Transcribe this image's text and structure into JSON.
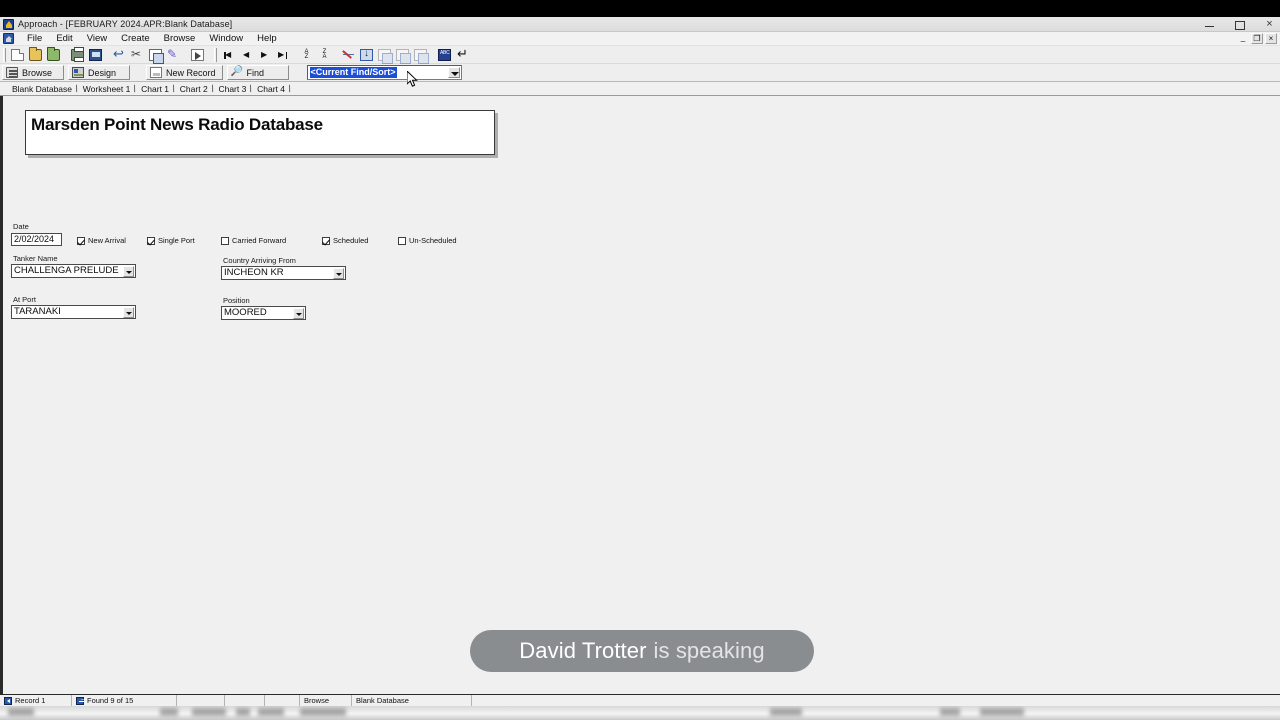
{
  "window": {
    "title": "Approach - [FEBRUARY 2024.APR:Blank Database]",
    "minimize_label": "",
    "maximize_label": "",
    "close_label": "×",
    "mdi_minimize_label": "_",
    "mdi_restore_label": "❐",
    "mdi_close_label": "×"
  },
  "menubar": {
    "items": [
      {
        "label": "File"
      },
      {
        "label": "Edit"
      },
      {
        "label": "View"
      },
      {
        "label": "Create"
      },
      {
        "label": "Browse"
      },
      {
        "label": "Window"
      },
      {
        "label": "Help"
      }
    ]
  },
  "toolbar": {
    "buttons": [
      {
        "name": "new-file-icon"
      },
      {
        "name": "open-folder-icon"
      },
      {
        "name": "save-folder-icon"
      },
      {
        "name": "print-icon"
      },
      {
        "name": "print-preview-icon"
      },
      {
        "name": "undo-icon"
      },
      {
        "name": "cut-icon"
      },
      {
        "name": "copy-icon"
      },
      {
        "name": "paste-format-icon"
      },
      {
        "name": "export-icon"
      },
      {
        "name": "first-record-icon"
      },
      {
        "name": "previous-record-icon"
      },
      {
        "name": "next-record-icon"
      },
      {
        "name": "last-record-icon"
      },
      {
        "name": "sort-ascending-icon"
      },
      {
        "name": "sort-descending-icon"
      },
      {
        "name": "clear-sort-icon"
      },
      {
        "name": "find-sort-icon"
      },
      {
        "name": "new-record-icon"
      },
      {
        "name": "duplicate-record-icon"
      },
      {
        "name": "delete-record-icon"
      },
      {
        "name": "spellcheck-icon"
      },
      {
        "name": "enter-icon"
      }
    ],
    "sort_asc_label": "A\nZ",
    "sort_desc_label": "Z\nA",
    "spell_label": "ABC"
  },
  "actionbar": {
    "browse_label": "Browse",
    "design_label": "Design",
    "new_record_label": "New Record",
    "find_label": "Find",
    "findsort_value": "<Current Find/Sort>",
    "findsort_placeholder": "<Current Find/Sort>"
  },
  "tabs": [
    {
      "label": "Blank Database",
      "active": true
    },
    {
      "label": "Worksheet 1",
      "active": false
    },
    {
      "label": "Chart 1",
      "active": false
    },
    {
      "label": "Chart 2",
      "active": false
    },
    {
      "label": "Chart 3",
      "active": false
    },
    {
      "label": "Chart 4",
      "active": false
    }
  ],
  "form": {
    "title": "Marsden Point News Radio Database",
    "fields": {
      "date": {
        "label": "Date",
        "value": "2/02/2024"
      },
      "tanker_name": {
        "label": "Tanker Name",
        "value": "CHALLENGA PRELUDE"
      },
      "country_arriving_from": {
        "label": "Country Arriving From",
        "value": "INCHEON KR"
      },
      "at_port": {
        "label": "At Port",
        "value": "TARANAKI"
      },
      "position": {
        "label": "Position",
        "value": "MOORED"
      }
    },
    "checkboxes": [
      {
        "label": "New Arrival",
        "checked": true
      },
      {
        "label": "Single Port",
        "checked": true
      },
      {
        "label": "Carried Forward",
        "checked": false
      },
      {
        "label": "Scheduled",
        "checked": true
      },
      {
        "label": "Un-Scheduled",
        "checked": false
      }
    ]
  },
  "overlay": {
    "speaker_name": "David Trotter",
    "speaking_suffix": "is speaking",
    "background_color": "#8a8d8f"
  },
  "statusbar": {
    "record_label": "Record 1",
    "found_label": "Found 9 of 15",
    "mode_label": "Browse",
    "view_label": "Blank Database"
  }
}
